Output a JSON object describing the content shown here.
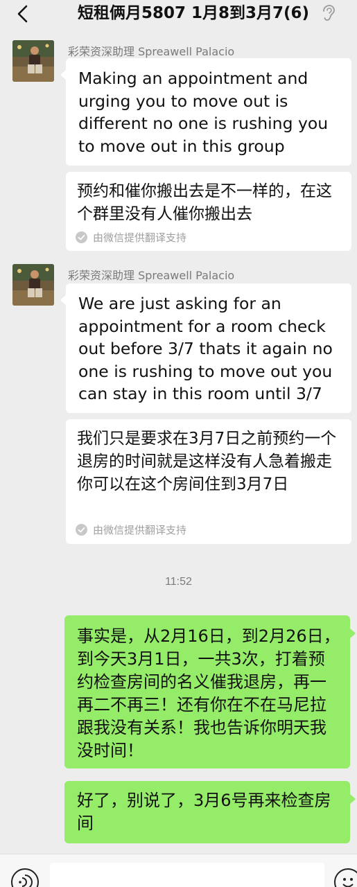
{
  "header": {
    "title": "短租俩月5807 1月8到3月7(6)",
    "back_icon": "chevron-left-icon",
    "ear_icon": "ear-icon"
  },
  "messages": [
    {
      "sender": "彩荣资深助理 Spreawell Palacio",
      "text": "Making an appointment and urging you to move out is different no one is rushing you to move out in this group",
      "translation": "预约和催你搬出去是不一样的，在这个群里没有人催你搬出去",
      "translation_source": "由微信提供翻译支持"
    },
    {
      "sender": "彩荣资深助理 Spreawell Palacio",
      "text": "We are just asking for an appointment for a room check out before 3/7 thats it again no one is rushing to move out you can stay in this room until 3/7",
      "translation": "我们只是要求在3月7日之前预约一个退房的时间就是这样没有人急着搬走你可以在这个房间住到3月7日",
      "translation_source": "由微信提供翻译支持"
    }
  ],
  "timestamp": "11:52",
  "outgoing": [
    {
      "text": "事实是，从2月16日，到2月26日，到今天3月1日，一共3次，打着预约检查房间的名义催我退房，再一再二不再三！还有你在不在马尼拉跟我没有关系！我也告诉你明天我没时间！"
    },
    {
      "text": "好了，别说了，3月6号再来检查房间"
    }
  ],
  "input_bar": {
    "voice_icon": "voice-icon",
    "emoji_icon": "emoji-icon",
    "input_placeholder": ""
  },
  "colors": {
    "background": "#ededed",
    "incoming_bubble": "#ffffff",
    "outgoing_bubble": "#95ec69"
  }
}
